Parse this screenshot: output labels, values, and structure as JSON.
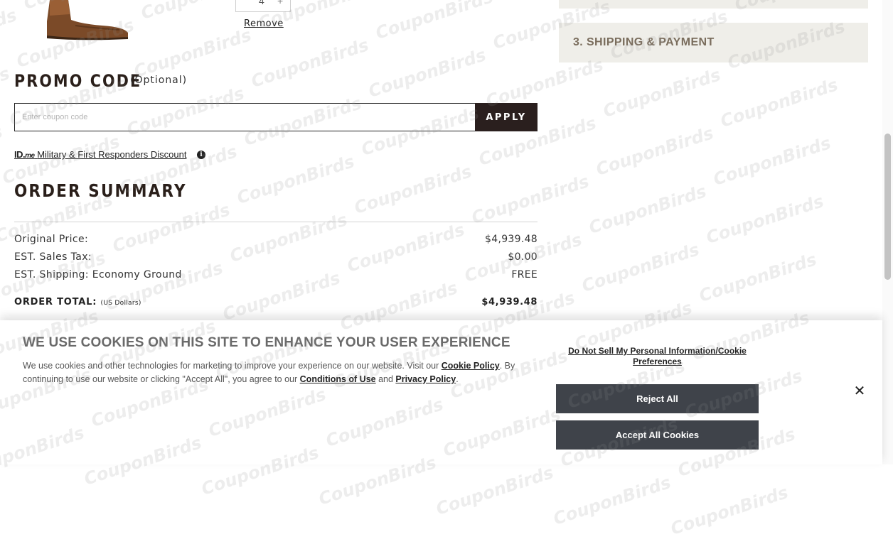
{
  "product": {
    "quantity": "4",
    "remove_label": "Remove"
  },
  "checkout_steps": {
    "shipping_payment": "3. SHIPPING & PAYMENT"
  },
  "promo": {
    "title": "PROMO CODE",
    "optional": "(Optional)",
    "placeholder": "Enter coupon code",
    "value": "",
    "apply_label": "APPLY",
    "idme_logo_text": "ID.",
    "idme_logo_suffix": "me",
    "idme_link_text": "Military & First Responders Discount"
  },
  "order_summary": {
    "title": "ORDER SUMMARY",
    "rows": [
      {
        "label": "Original Price:",
        "value": "$4,939.48"
      },
      {
        "label": "EST. Sales Tax:",
        "value": "$0.00"
      },
      {
        "label": "EST. Shipping: Economy Ground",
        "value": "FREE"
      }
    ],
    "total_label": "ORDER TOTAL:",
    "total_currency_note": "(US Dollars)",
    "total_value": "$4,939.48"
  },
  "cookie_banner": {
    "title": "WE USE COOKIES ON THIS SITE TO ENHANCE YOUR USER EXPERIENCE",
    "text_part1": "We use cookies and other technologies for marketing to improve your experience on our website. Visit our ",
    "cookie_policy_link": "Cookie Policy",
    "text_part2": ". By continuing to use our website or clicking \"Accept All\", you agree to our ",
    "conditions_link": "Conditions of Use",
    "text_part3": " and ",
    "privacy_link": "Privacy Policy",
    "text_part4": ".",
    "do_not_sell_link": "Do Not Sell My Personal Information/Cookie Preferences",
    "reject_label": "Reject All",
    "accept_label": "Accept All Cookies",
    "close_glyph": "✕"
  },
  "watermark": {
    "text": "CouponBirds"
  },
  "colors": {
    "apply_button": "#2a1f1e",
    "step_background": "#efeee9",
    "step_text": "#7a6d5d",
    "banner_button": "#3f434a"
  }
}
